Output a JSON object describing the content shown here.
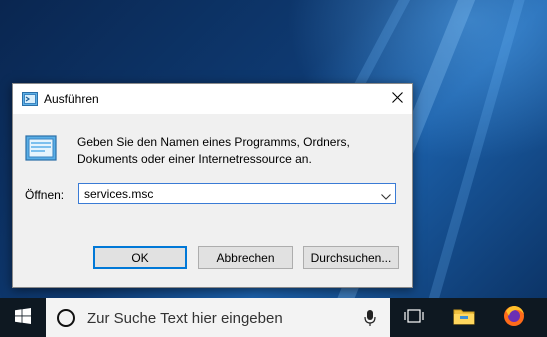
{
  "dialog": {
    "title": "Ausführen",
    "description": "Geben Sie den Namen eines Programms, Ordners, Dokuments oder einer Internetressource an.",
    "open_label": "Öffnen:",
    "open_value": "services.msc",
    "ok_label": "OK",
    "cancel_label": "Abbrechen",
    "browse_label": "Durchsuchen..."
  },
  "taskbar": {
    "search_placeholder": "Zur Suche Text hier eingeben",
    "icons": [
      "windows-start-icon",
      "cortana-icon",
      "microphone-icon",
      "task-view-icon",
      "file-explorer-icon",
      "firefox-icon"
    ]
  },
  "colors": {
    "accent": "#0078d7",
    "taskbar": "#0e1821",
    "dialog_bg": "#f0f0f0"
  }
}
